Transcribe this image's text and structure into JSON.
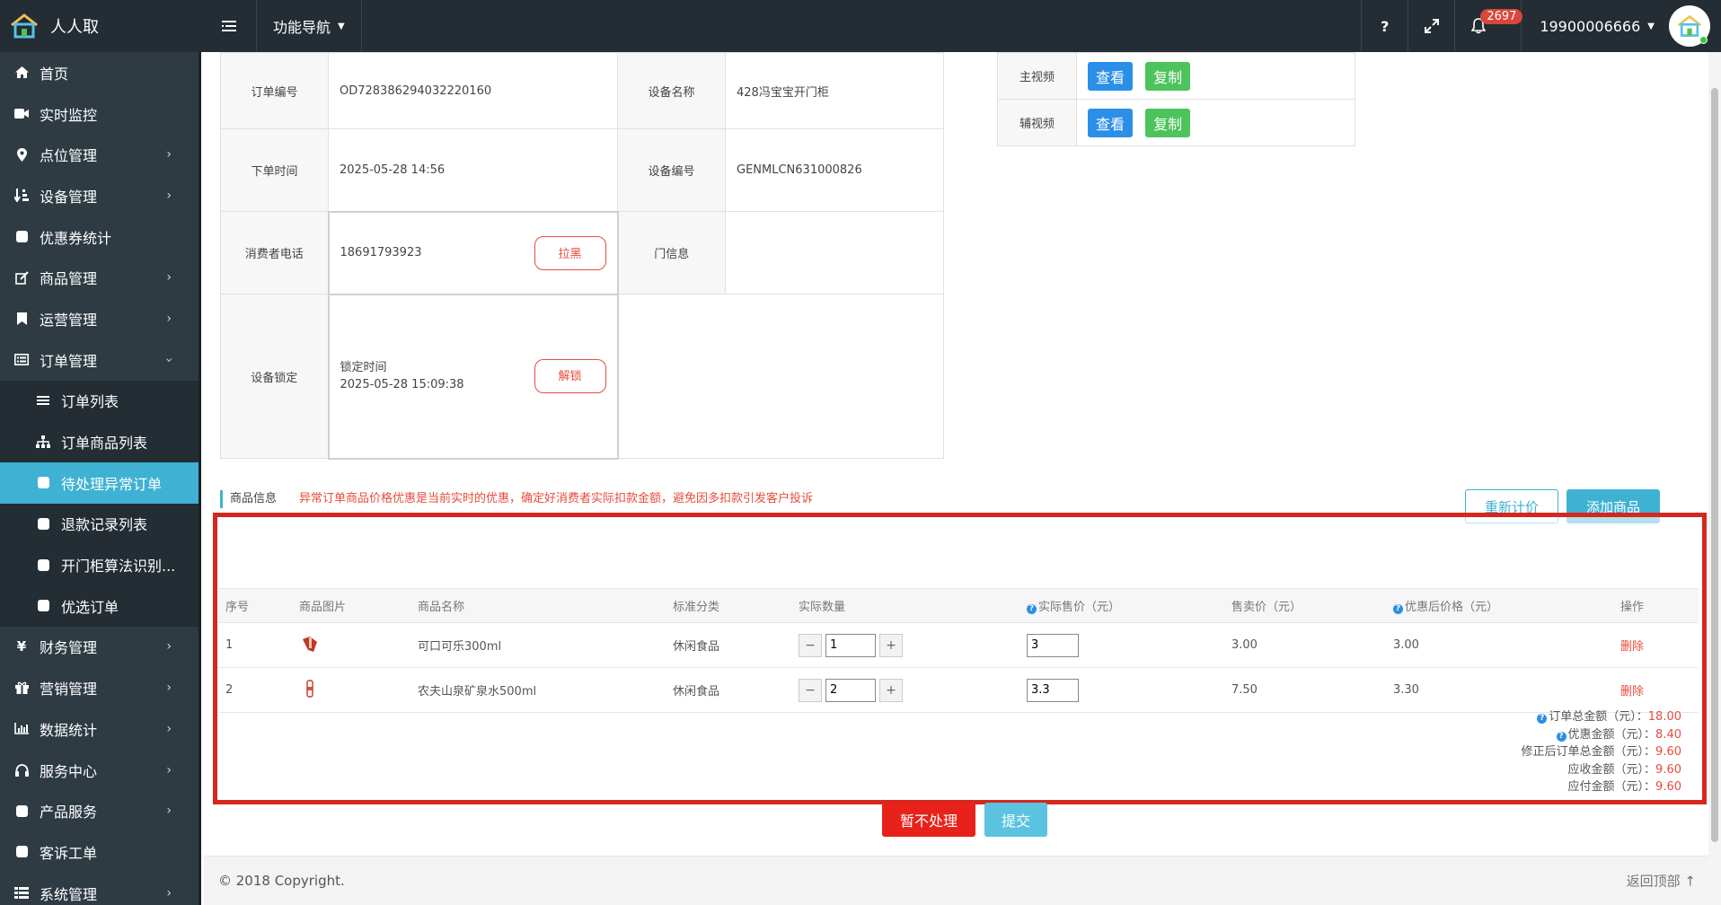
{
  "header": {
    "app_name": "人人取",
    "func_nav_label": "功能导航",
    "help_label": "?",
    "notifications_count": "2697",
    "user_phone": "19900006666"
  },
  "sidebar": {
    "items": [
      {
        "label": "首页",
        "icon": "home-icon",
        "has_children": false
      },
      {
        "label": "实时监控",
        "icon": "video-camera-icon",
        "has_children": false
      },
      {
        "label": "点位管理",
        "icon": "map-marker-icon",
        "has_children": true
      },
      {
        "label": "设备管理",
        "icon": "sort-icon",
        "has_children": true
      },
      {
        "label": "优惠券统计",
        "icon": "square-icon",
        "has_children": false
      },
      {
        "label": "商品管理",
        "icon": "edit-icon",
        "has_children": true
      },
      {
        "label": "运营管理",
        "icon": "bookmark-icon",
        "has_children": true
      },
      {
        "label": "订单管理",
        "icon": "list-alt-icon",
        "has_children": true,
        "expanded": true
      }
    ],
    "order_sub_items": [
      {
        "label": "订单列表",
        "icon": "list-icon",
        "active": false
      },
      {
        "label": "订单商品列表",
        "icon": "sitemap-icon",
        "active": false
      },
      {
        "label": "待处理异常订单",
        "icon": "square-icon",
        "active": true
      },
      {
        "label": "退款记录列表",
        "icon": "square-icon",
        "active": false
      },
      {
        "label": "开门柜算法识别...",
        "icon": "square-icon",
        "active": false
      },
      {
        "label": "优选订单",
        "icon": "square-icon",
        "active": false
      }
    ],
    "items_after": [
      {
        "label": "财务管理",
        "icon": "yen-icon",
        "has_children": true
      },
      {
        "label": "营销管理",
        "icon": "gift-icon",
        "has_children": true
      },
      {
        "label": "数据统计",
        "icon": "bar-chart-icon",
        "has_children": true
      },
      {
        "label": "服务中心",
        "icon": "headphones-icon",
        "has_children": true
      },
      {
        "label": "产品服务",
        "icon": "square-icon",
        "has_children": true
      },
      {
        "label": "客诉工单",
        "icon": "square-icon",
        "has_children": false
      },
      {
        "label": "系统管理",
        "icon": "th-list-icon",
        "has_children": true
      }
    ]
  },
  "order_info": {
    "order_no_label": "订单编号",
    "order_no": "OD728386294032220160",
    "device_name_label": "设备名称",
    "device_name": "428冯宝宝开门柜",
    "order_time_label": "下单时间",
    "order_time": "2025-05-28 14:56",
    "device_no_label": "设备编号",
    "device_no": "GENMLCN631000826",
    "phone_label": "消费者电话",
    "phone": "18691793923",
    "blacklist_label": "拉黑",
    "door_info_label": "门信息",
    "door_info": "",
    "lock_label": "设备锁定",
    "lock_time_label": "锁定时间",
    "lock_time": "2025-05-28 15:09:38",
    "unlock_label": "解锁"
  },
  "videos": {
    "main_label": "主视频",
    "aux_label": "辅视频",
    "view_label": "查看",
    "copy_label": "复制"
  },
  "goods": {
    "section_title": "商品信息",
    "warning": "异常订单商品价格优惠是当前实时的优惠，确定好消费者实际扣款金额，避免因多扣款引发客户投诉",
    "recalc_label": "重新计价",
    "add_label": "添加商品",
    "headers": {
      "seq": "序号",
      "image": "商品图片",
      "name": "商品名称",
      "category": "标准分类",
      "qty": "实际数量",
      "actual_price": "实际售价（元）",
      "sale_price": "售卖价（元）",
      "discount_price": "优惠后价格（元）",
      "action": "操作"
    },
    "rows": [
      {
        "seq": "1",
        "name": "可口可乐300ml",
        "category": "休闲食品",
        "qty": "1",
        "actual_price": "3",
        "sale_price": "3.00",
        "discount_price": "3.00",
        "action": "删除"
      },
      {
        "seq": "2",
        "name": "农夫山泉矿泉水500ml",
        "category": "休闲食品",
        "qty": "2",
        "actual_price": "3.3",
        "sale_price": "7.50",
        "discount_price": "3.30",
        "action": "删除"
      }
    ],
    "step_minus": "−",
    "step_plus": "+"
  },
  "totals": {
    "order_total_label": "订单总金额（元）：",
    "order_total": "18.00",
    "discount_label": "优惠金额（元）：",
    "discount": "8.40",
    "corrected_total_label": "修正后订单总金额（元）：",
    "corrected_total": "9.60",
    "receivable_label": "应收金额（元）：",
    "receivable": "9.60",
    "payable_label": "应付金额（元）：",
    "payable": "9.60"
  },
  "actions": {
    "hold_label": "暂不处理",
    "submit_label": "提交"
  },
  "footer": {
    "copyright": "© 2018 Copyright.",
    "back_top": "返回顶部"
  },
  "colors": {
    "topbar": "#232d33",
    "sidebar": "#2e3b43",
    "accent": "#3fb2d3",
    "danger": "#e74c3c",
    "frame_red": "#d6261e"
  }
}
